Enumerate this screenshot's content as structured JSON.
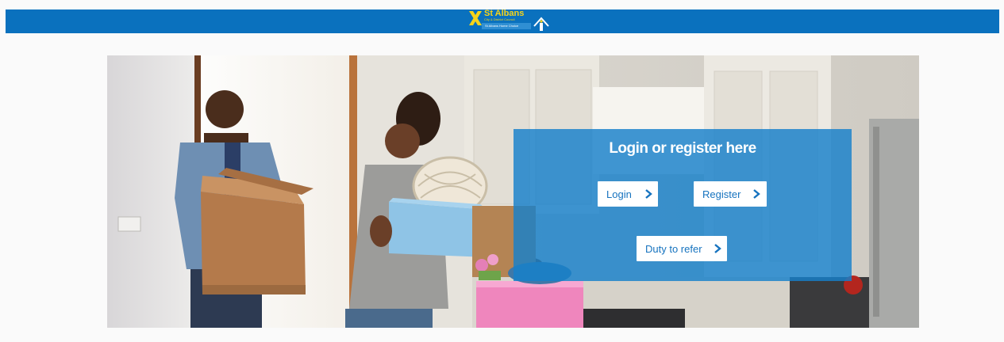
{
  "header": {
    "logo": {
      "name": "St Albans",
      "subtitle": "City & District Council",
      "tagline": "St Albans Home Choice"
    }
  },
  "hero": {
    "image": "people-moving-boxes-kitchen"
  },
  "panel": {
    "title": "Login or register here",
    "login_label": "Login",
    "register_label": "Register",
    "duty_label": "Duty to refer"
  },
  "colors": {
    "header_bg": "#0a71be",
    "panel_bg": "#1680ca",
    "button_text": "#1673bf",
    "logo_yellow": "#f5d31a"
  }
}
